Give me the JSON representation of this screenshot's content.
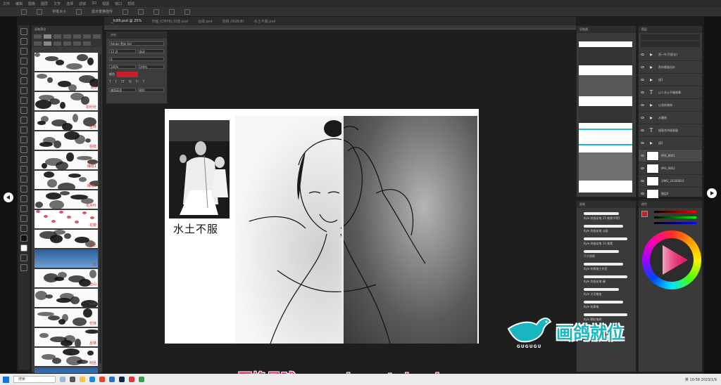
{
  "menubar": {
    "items": [
      "文件",
      "编辑",
      "图像",
      "图层",
      "文字",
      "选择",
      "滤镜",
      "3D",
      "视图",
      "窗口",
      "帮助"
    ]
  },
  "options": {
    "mode": "字体大小",
    "toggle": "显示变换控件"
  },
  "tabs": [
    "_fc89.psd @ 25%",
    "作画 (CMYK) 抖音.psd",
    "合成.psd",
    "完稿 (RGB/8)",
    "水土不服.psd"
  ],
  "left_panel": {
    "title": "画笔预设",
    "brushes": [
      {
        "label": "",
        "kind": "ink"
      },
      {
        "label": "树5",
        "kind": "ink"
      },
      {
        "label": "松叶针",
        "kind": "ink"
      },
      {
        "label": "密林",
        "kind": "ink"
      },
      {
        "label": "枯枝",
        "kind": "ink"
      },
      {
        "label": "梅枝1",
        "kind": "ink"
      },
      {
        "label": "梅枝2",
        "kind": "ink"
      },
      {
        "label": "花卉叶",
        "kind": "ink"
      },
      {
        "label": "花瓣",
        "kind": "pink"
      },
      {
        "label": "草丛",
        "kind": "ink"
      },
      {
        "label": "云",
        "kind": "sky"
      },
      {
        "label": "远山",
        "kind": "ink"
      },
      {
        "label": "山水",
        "kind": "ink"
      },
      {
        "label": "竹林",
        "kind": "ink"
      },
      {
        "label": "丛林",
        "kind": "ink"
      },
      {
        "label": "树丛",
        "kind": "ink"
      },
      {
        "label": "",
        "kind": "sky"
      }
    ]
  },
  "char_panel": {
    "title": "字符",
    "font": "Adobe 黑体 Std",
    "size": "12 点",
    "leading": "自动",
    "tracking": "0",
    "scale_v": "100%",
    "scale_h": "100%",
    "color_label": "颜色",
    "lang": "美国英语",
    "aa": "锐利"
  },
  "canvas": {
    "caption": "水土不服",
    "zoom": "25%"
  },
  "layers_panel": {
    "title": "图层",
    "rows": [
      {
        "name": "吞一叶子组(右)",
        "kind": "folder"
      },
      {
        "name": "吞叶梗画出叶",
        "kind": "folder"
      },
      {
        "name": "组1",
        "kind": "folder"
      },
      {
        "name": "以人水土不服故事",
        "kind": "text"
      },
      {
        "name": "以花枝装饰",
        "kind": "folder"
      },
      {
        "name": "水墨画",
        "kind": "folder"
      },
      {
        "name": "插画合作插画展",
        "kind": "text"
      },
      {
        "name": "组2",
        "kind": "folder"
      },
      {
        "name": "IMG_8801",
        "kind": "thumb"
      },
      {
        "name": "IMG_8802",
        "kind": "thumb"
      },
      {
        "name": "1IMG_20180816",
        "kind": "thumb"
      },
      {
        "name": "图层4",
        "kind": "thumb"
      },
      {
        "name": "图层5",
        "kind": "thumb"
      }
    ]
  },
  "brushes_panel": {
    "title": "画笔",
    "items": [
      "Kyle 终极炭笔 25 像素中等1",
      "Kyle 终极炭笔 淡彩",
      "Kyle 终极炭笔 10 像素",
      "干介质刷",
      "Kyle 的啄笔工作室",
      "Kyle 终极炭笔-硬",
      "Kyle 大号橡皮",
      "Kyle 轮廓笔",
      "Kyle 颗粒笔刷"
    ]
  },
  "watermark": "互换星球 www.irasutobook.com",
  "logo": {
    "brand": "画鸽就位",
    "sub": "GUGUGU"
  },
  "taskbar": {
    "search": "搜索",
    "time": "10:58",
    "date": "2023/1/9",
    "lang": "英"
  },
  "colors": {
    "accent": "#1ab8d8",
    "red": "#c4202b",
    "pink": "#e3216f",
    "teal": "#19b5c0"
  }
}
